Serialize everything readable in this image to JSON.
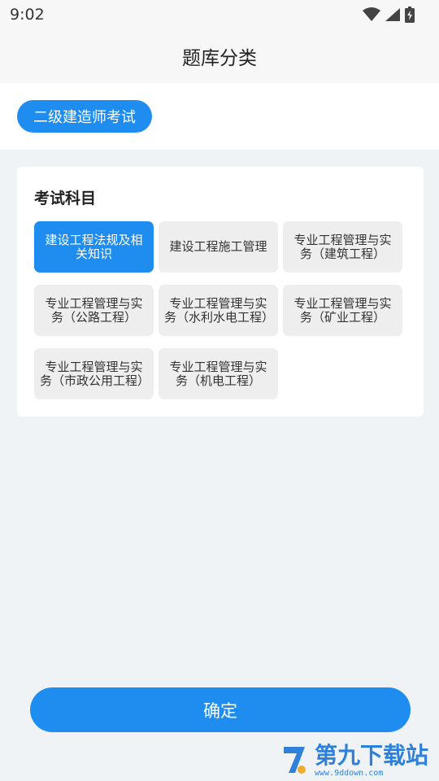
{
  "status_bar": {
    "time": "9:02",
    "icons": [
      "wifi-icon",
      "signal-icon",
      "battery-icon"
    ]
  },
  "header": {
    "title": "题库分类"
  },
  "category": {
    "selected_label": "二级建造师考试"
  },
  "section": {
    "title": "考试科目",
    "subjects": [
      {
        "label": "建设工程法规及相关知识",
        "selected": true
      },
      {
        "label": "建设工程施工管理",
        "selected": false
      },
      {
        "label": "专业工程管理与实务（建筑工程）",
        "selected": false
      },
      {
        "label": "专业工程管理与实务（公路工程）",
        "selected": false
      },
      {
        "label": "专业工程管理与实务（水利水电工程）",
        "selected": false
      },
      {
        "label": "专业工程管理与实务（矿业工程）",
        "selected": false
      },
      {
        "label": "专业工程管理与实务（市政公用工程）",
        "selected": false
      },
      {
        "label": "专业工程管理与实务（机电工程）",
        "selected": false
      }
    ]
  },
  "footer": {
    "confirm_label": "确定"
  },
  "watermark": {
    "main": "第九下载站",
    "sub": "www.9ddown.com"
  },
  "colors": {
    "accent": "#1f8cf0",
    "chip_bg": "#eeeeee",
    "page_bg": "#eff3f6"
  }
}
